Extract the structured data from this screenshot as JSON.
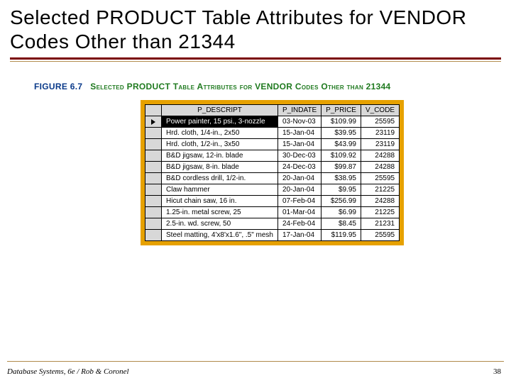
{
  "title": "Selected PRODUCT Table Attributes for VENDOR Codes Other than 21344",
  "figure": {
    "number": "FIGURE 6.7",
    "caption": "Selected PRODUCT Table Attributes for VENDOR Codes Other than 21344"
  },
  "columns": [
    "P_DESCRIPT",
    "P_INDATE",
    "P_PRICE",
    "V_CODE"
  ],
  "rows": [
    {
      "descript": "Power painter, 15 psi., 3-nozzle",
      "indate": "03-Nov-03",
      "price": "$109.99",
      "vcode": "25595",
      "selected": true
    },
    {
      "descript": "Hrd. cloth, 1/4-in., 2x50",
      "indate": "15-Jan-04",
      "price": "$39.95",
      "vcode": "23119"
    },
    {
      "descript": "Hrd. cloth, 1/2-in., 3x50",
      "indate": "15-Jan-04",
      "price": "$43.99",
      "vcode": "23119"
    },
    {
      "descript": "B&D jigsaw, 12-in. blade",
      "indate": "30-Dec-03",
      "price": "$109.92",
      "vcode": "24288"
    },
    {
      "descript": "B&D jigsaw, 8-in. blade",
      "indate": "24-Dec-03",
      "price": "$99.87",
      "vcode": "24288"
    },
    {
      "descript": "B&D cordless drill, 1/2-in.",
      "indate": "20-Jan-04",
      "price": "$38.95",
      "vcode": "25595"
    },
    {
      "descript": "Claw hammer",
      "indate": "20-Jan-04",
      "price": "$9.95",
      "vcode": "21225"
    },
    {
      "descript": "Hicut chain saw, 16 in.",
      "indate": "07-Feb-04",
      "price": "$256.99",
      "vcode": "24288"
    },
    {
      "descript": "1.25-in. metal screw, 25",
      "indate": "01-Mar-04",
      "price": "$6.99",
      "vcode": "21225"
    },
    {
      "descript": "2.5-in. wd. screw, 50",
      "indate": "24-Feb-04",
      "price": "$8.45",
      "vcode": "21231"
    },
    {
      "descript": "Steel matting, 4'x8'x1.6\", .5\" mesh",
      "indate": "17-Jan-04",
      "price": "$119.95",
      "vcode": "25595"
    }
  ],
  "footer": {
    "left": "Database Systems, 6e / Rob & Coronel",
    "page": "38"
  }
}
